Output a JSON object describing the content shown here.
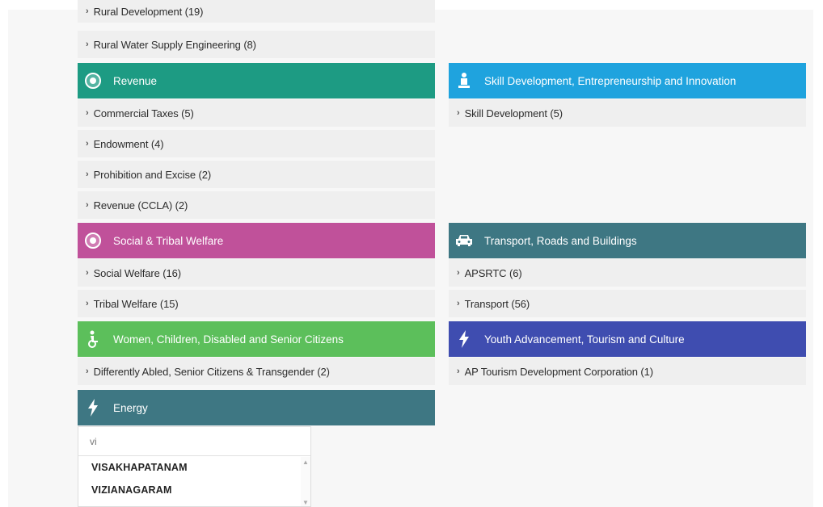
{
  "left_column": {
    "top_items": [
      {
        "label": "Rural Development (19)"
      },
      {
        "label": "Rural Water Supply Engineering (8)"
      }
    ],
    "revenue": {
      "title": "Revenue",
      "color": "#1d9b83",
      "icon": "clock-badge-icon",
      "items": [
        {
          "label": "Commercial Taxes (5)"
        },
        {
          "label": "Endowment (4)"
        },
        {
          "label": "Prohibition and Excise (2)"
        },
        {
          "label": "Revenue (CCLA) (2)"
        }
      ]
    },
    "social": {
      "title": "Social & Tribal Welfare",
      "color": "#c0519a",
      "icon": "people-badge-icon",
      "items": [
        {
          "label": "Social Welfare (16)"
        },
        {
          "label": "Tribal Welfare (15)"
        }
      ]
    },
    "women": {
      "title": "Women, Children, Disabled and Senior Citizens",
      "color": "#5cbf5b",
      "icon": "wheelchair-icon",
      "items": [
        {
          "label": "Differently Abled, Senior Citizens & Transgender (2)"
        }
      ]
    },
    "energy": {
      "title": "Energy",
      "color": "#3e7783",
      "icon": "lightning-icon"
    }
  },
  "right_column": {
    "skill": {
      "title": "Skill Development, Entrepreneurship and Innovation",
      "color": "#1fa3de",
      "icon": "presenter-icon",
      "items": [
        {
          "label": "Skill Development (5)"
        }
      ]
    },
    "transport": {
      "title": "Transport, Roads and Buildings",
      "color": "#3e7783",
      "icon": "car-icon",
      "items": [
        {
          "label": "APSRTC (6)"
        },
        {
          "label": "Transport (56)"
        }
      ]
    },
    "youth": {
      "title": "Youth Advancement, Tourism and Culture",
      "color": "#3f4db0",
      "icon": "lightning-icon",
      "items": [
        {
          "label": "AP Tourism Development Corporation (1)"
        }
      ]
    }
  },
  "search_dropdown": {
    "value": "vi",
    "options": [
      "VISAKHAPATANAM",
      "VIZIANAGARAM"
    ]
  }
}
